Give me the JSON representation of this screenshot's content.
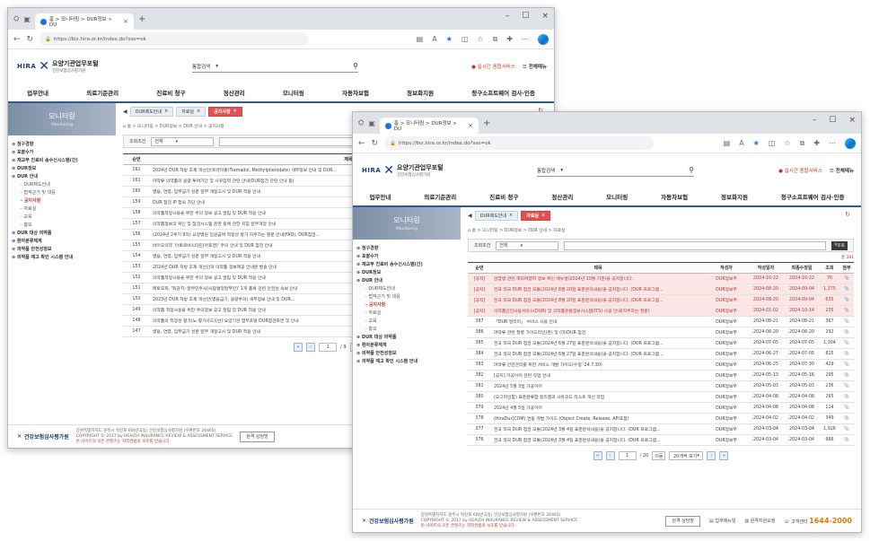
{
  "browser": {
    "tab_title": "홈 > 모니터링 > DUR정보 > DU",
    "url": "https://biz.hira.or.kr/index.do?sso=ok",
    "favorites_text": "A"
  },
  "site": {
    "logo_en": "HIRA",
    "logo_kr": "요양기관업무포털",
    "logo_sub": "건강보험심사평가원",
    "search_label": "통합검색",
    "realtime_link": "실시간 종합서비스",
    "fullmenu_link": "전체메뉴",
    "gnb": [
      "업무안내",
      "의료기준관리",
      "진료비 청구",
      "정산관리",
      "모니터링",
      "자동차보험",
      "정보화지원",
      "청구소프트웨어 검사·인증"
    ]
  },
  "w1": {
    "lnb_title": "모니터링",
    "lnb_sub": "Monitoring",
    "lnb_items": [
      {
        "t": "청구경향",
        "lvl": "l0"
      },
      {
        "t": "포괄수가",
        "lvl": "l0"
      },
      {
        "t": "재교부 진료비 송수신시스템(간)",
        "lvl": "l0"
      },
      {
        "t": "DUR정보",
        "lvl": "l0"
      },
      {
        "t": "DUR 안내",
        "lvl": "l0"
      },
      {
        "t": "DUR제도안내",
        "lvl": "l1"
      },
      {
        "t": "법적근거 및 대응",
        "lvl": "l1"
      },
      {
        "t": "공지사항",
        "lvl": "l1 on"
      },
      {
        "t": "자료실",
        "lvl": "l1"
      },
      {
        "t": "교육",
        "lvl": "l1"
      },
      {
        "t": "홍보",
        "lvl": "l1"
      },
      {
        "t": "DUR 대상 의약품",
        "lvl": "l0"
      },
      {
        "t": "환자분류체계",
        "lvl": "l0"
      },
      {
        "t": "의약품 안전성정보",
        "lvl": "l0"
      },
      {
        "t": "의약품 재고 확인 시스템 안내",
        "lvl": "l0"
      }
    ],
    "ctabs": [
      "DUR제도안내",
      "자료실",
      "공지사항"
    ],
    "breadcrumb": "홈 > 모니터링 > DUR정보 > DUR 안내 > 공지사항",
    "filter_label": "조회조건",
    "filter_value": "전체",
    "headers": [
      "순번",
      "제목"
    ],
    "rows": [
      [
        "162",
        "2024년 DUR 처방 조제 개선안(트라마돌(Tramadol, Methylphenidate) 세부정보 안내 및 DUR..."
      ],
      [
        "161",
        "마약류 의약품의 용량·투여기간 및 사유입력 관련 안내(DUR점검 관련 안내 등)"
      ],
      [
        "160",
        "병용, 연령, 임부금기 성분 일부 개정고시 및 DUR 적용 안내"
      ],
      [
        "159",
        "DUR 점검 IP 접속 차단 안내"
      ],
      [
        "158",
        "의약품적정사용을 위한 주의 정보 공고 알림 및 DUR 적용 안내"
      ],
      [
        "157",
        "의약품정보의 확인 및 점검시스템 운영 등에 관한 지침 일부개정 안내"
      ],
      [
        "156",
        "(2024년 2주기 9차) 요양병원 입원급여 적정성 평가 자주하는 질문 안내(FAQ), DUR점검..."
      ],
      [
        "155",
        "바이오의약 '아토르바스타틴(아토젠)' 주의 안내 및 DUR 점검 안내"
      ],
      [
        "154",
        "병용, 연령, 임부금기 성분 일부 개정고시 및 DUR 적용 안내"
      ],
      [
        "153",
        "2024년 DUR 처방 조제 개선안과 의약품 정보제공 안내문 발송 안내"
      ],
      [
        "152",
        "의약품적정사용을 위한 주의 정보 공고 알림 및 DUR 적용 안내"
      ],
      [
        "151",
        "메토오피, '독감치··알부민주사(사람혈청알부민)' 1개 품목 관련 안전성 속보 안내"
      ],
      [
        "150",
        "2023년 DUR 처방 조제 개선안(병용금기, 용량주의) 세부정보 안내 및 DUR..."
      ],
      [
        "149",
        "의약품 적정사용을 위한 주의정보 공고 알림 및 DUR 적용 안내"
      ],
      [
        "148",
        "의약품의 적정성 평가(노·항가사드)(반) 요양기관 업무포털 DUR점검화면 및 안내"
      ],
      [
        "147",
        "병용, 연령, 임부금기 성분 일부 개정고시 및 DUR 적용 안내"
      ]
    ],
    "pager": {
      "current": "1",
      "total": "/ 9",
      "go": "이동"
    }
  },
  "w2": {
    "ctabs": [
      "DUR제도안내",
      "자료실"
    ],
    "breadcrumb": "홈 > 모니터링 > DUR정보 > DUR 안내 > 자료실",
    "filter_label": "조회조건",
    "filter_value": "전체",
    "search_btn": "조회",
    "count_label": "총 381",
    "headers": [
      "순번",
      "제목",
      "작성자",
      "작성일자",
      "최종수정일",
      "조회",
      "첨부"
    ],
    "rows": [
      [
        "[공지]",
        "감염병 관련 해외여행력 정보 확인 매뉴얼(2024년 10월 기준)을 공지합니다.",
        "DUR정보부",
        "2024-10-22",
        "2024-10-22",
        "76",
        "📎",
        "pin"
      ],
      [
        "[공지]",
        "전국 약국 DUR 점검 모듈(2024년 8월 20일 표준분석내용)을 공지합니다. (DUR 프로그램...",
        "DUR정보부",
        "2024-08-20",
        "2024-09-04",
        "1,275",
        "📎",
        "pin"
      ],
      [
        "[공지]",
        "전국 약국 DUR 점검 모듈(2024년 8월 20일 표준분석내용)을 공지합니다. (DUR 프로그램...",
        "DUR정보부",
        "2024-08-20",
        "2024-09-04",
        "635",
        "📎",
        "pin"
      ],
      [
        "[공지]",
        "의약품안전사용서비스(DUR) 및 의약품유통정보시스템(ITS) 사용 안내(자주하는 질문)",
        "DUR정보부",
        "2024-01-02",
        "2024-10-14",
        "235",
        "📎",
        "pin"
      ],
      [
        "387",
        "「DUR 알리미」 서비스 사용 안내",
        "DUR정보부",
        "2024-08-21",
        "2024-08-21",
        "367",
        "📎",
        ""
      ],
      [
        "386",
        "마약류 관련 질병 가이드라인(본) 및 (마)DUR 점검",
        "DUR정보부",
        "2024-08-20",
        "2024-08-20",
        "292",
        "📎",
        ""
      ],
      [
        "385",
        "전국 약국 DUR 점검 모듈(2024년 6월 27일 표준분석내용)을 공지합니다. (DUR 프로그램...",
        "DUR정보부",
        "2024-07-05",
        "2024-07-05",
        "1,304",
        "📎",
        ""
      ],
      [
        "384",
        "전국 약국 DUR 점검 모듈(2024년 6월 27일 표준분석내용)을 공지합니다. (DUR 프로그램...",
        "DUR정보부",
        "2024-06-27",
        "2024-07-05",
        "815",
        "📎",
        ""
      ],
      [
        "383",
        "마약류 안전관리를 위한 서비스 개발 가이드(수정 '24.7.30)",
        "DUR정보부",
        "2024-06-25",
        "2024-07-30",
        "429",
        "📎",
        ""
      ],
      [
        "382",
        "[공지] 가공이어 관련 작업 안내",
        "DUR정보부",
        "2024-05-13",
        "2024-05-16",
        "295",
        "📎",
        ""
      ],
      [
        "381",
        "2024년 5월 3일 가공이어",
        "DUR정보부",
        "2024-05-03",
        "2024-05-03",
        "236",
        "📎",
        ""
      ],
      [
        "380",
        "(오그파인함) 표준분류항 정리결과 사유코드 리스트 개선 작업",
        "DUR정보부",
        "2024-04-08",
        "2024-04-08",
        "265",
        "📎",
        ""
      ],
      [
        "379",
        "2024년 4월 5일 가공이어",
        "DUR정보부",
        "2024-04-08",
        "2024-04-08",
        "114",
        "📎",
        ""
      ],
      [
        "378",
        "(HiraDur(COM) 연동 개발 가이드 (Object Create, Release, API포함)",
        "DUR정보부",
        "2024-04-02",
        "2024-04-02",
        "349",
        "📎",
        ""
      ],
      [
        "377",
        "전국 약국 DUR 점검 모듈(2024년 3월 4일 표준분석내용)을 공지합니다. (DUR 프로그램...",
        "DUR정보부",
        "2024-03-04",
        "2024-03-04",
        "1,926",
        "📎",
        ""
      ],
      [
        "376",
        "전국 약국 DUR 점검 모듈(2024년 3월 4일 표준분석내용)을 공지합니다. (DUR 프로그램...",
        "DUR정보부",
        "2024-03-04",
        "2024-03-04",
        "966",
        "📎",
        ""
      ]
    ],
    "pager": {
      "current": "1",
      "total": "/ 20",
      "go": "이동",
      "per_page": "20개씩 보기"
    }
  },
  "footer": {
    "logo": "건강보험심사평가원",
    "address": "강원특별자치도 원주시 혁신로 60(반곡동) 건강보험심사평가원 (우편번호 26465)",
    "copyright": "COPYRIGHT © 2017 by HEALTH INSURANCE REVIEW & ASSESSMENT SERVICE",
    "note": "본 사이트의 모든 콘텐츠는 저작권법의 보호를 받습니다.",
    "consult_btn": "원격 상담방",
    "links": [
      "업무매뉴얼",
      "원격지원요청"
    ],
    "phone_label": "고객센터",
    "phone": "1644-2000"
  }
}
